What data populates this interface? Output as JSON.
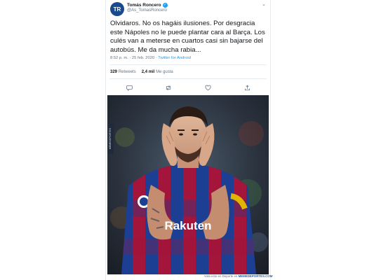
{
  "tweet": {
    "author_name": "Tomás Roncero",
    "author_handle": "@As_TomasRoncero",
    "avatar_initials": "TR",
    "text": "Olvidaros. No os hagáis ilusiones. Por desgracia este Nápoles no le puede plantar cara al Barça. Los culés van a meterse en cuartos casi sin bajarse del autobús. Me da mucha rabia...",
    "time": "8:52 p. m. · 25 feb. 2020 · ",
    "source": "Twitter for Android",
    "retweets_count": "329",
    "retweets_label": "Retweets",
    "likes_count": "2,4 mil",
    "likes_label": "Me gusta"
  },
  "icons": {
    "verified": "verified-badge-icon",
    "caret": "chevron-down-icon",
    "reply": "reply-icon",
    "retweet": "retweet-icon",
    "like": "heart-icon",
    "share": "share-icon"
  },
  "photo": {
    "jersey_text": "Rakuten",
    "side_watermark": "MEMEDEPORTES"
  },
  "caption": {
    "prefix": "Vota esto en Deporte en ",
    "site": "MEMEDEPORTES.COM"
  },
  "colors": {
    "accent": "#1da1f2",
    "text": "#14171a",
    "muted": "#657786",
    "barca_blue": "#1c3f94",
    "barca_red": "#a3153a"
  }
}
